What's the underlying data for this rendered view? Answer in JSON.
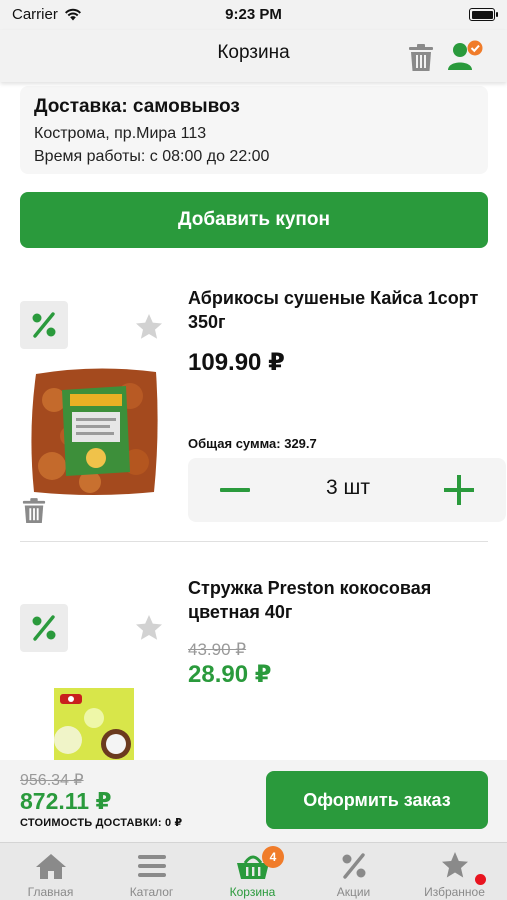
{
  "status_bar": {
    "carrier": "Carrier",
    "time": "9:23 PM"
  },
  "nav": {
    "title": "Корзина"
  },
  "delivery": {
    "heading": "Доставка: самовывоз",
    "address": "Кострома, пр.Мира 113",
    "hours": "Время работы: с 08:00 до 22:00"
  },
  "coupon_button": "Добавить купон",
  "items": [
    {
      "name": "Абрикосы сушеные Кайса 1сорт 350г",
      "price": "109.90 ₽",
      "sum": "Общая сумма: 329.7",
      "quantity": "3 шт"
    },
    {
      "name": "Стружка Preston кокосовая цветная 40г",
      "old_price": "43.90 ₽",
      "price": "28.90 ₽"
    }
  ],
  "summary": {
    "old_total": "956.34 ₽",
    "total": "872.11 ₽",
    "delivery_cost": "СТОИМОСТЬ ДОСТАВКИ: 0 ₽",
    "checkout_button": "Оформить заказ"
  },
  "tabs": [
    {
      "label": "Главная",
      "icon": "home-icon"
    },
    {
      "label": "Каталог",
      "icon": "menu-icon"
    },
    {
      "label": "Корзина",
      "icon": "basket-icon",
      "badge": "4",
      "active": true
    },
    {
      "label": "Акции",
      "icon": "percent-icon"
    },
    {
      "label": "Избранное",
      "icon": "star-icon"
    }
  ],
  "colors": {
    "accent": "#2a9a3c",
    "badge": "#f07c2a",
    "notify_dot": "#e8141f"
  }
}
